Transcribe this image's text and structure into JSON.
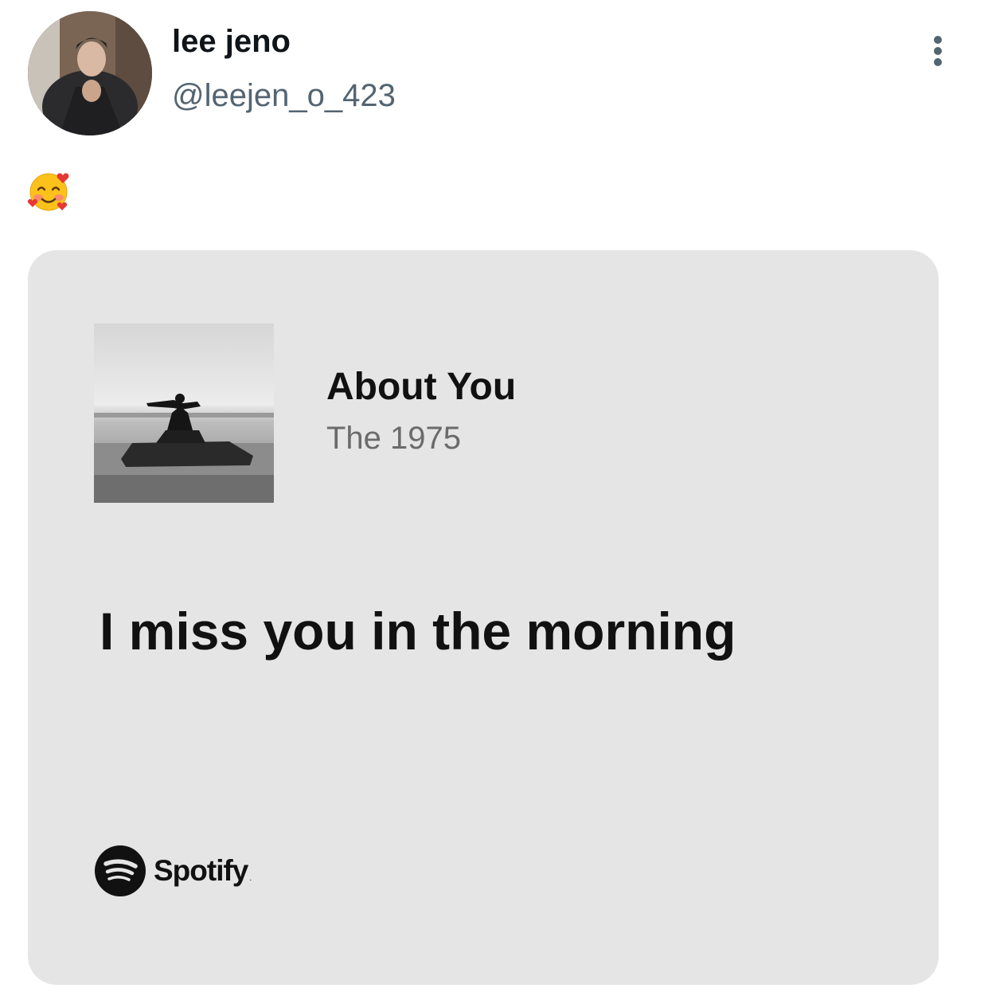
{
  "post": {
    "author": {
      "display_name": "lee jeno",
      "handle": "@leejen_o_423",
      "avatar": "profile-photo"
    },
    "menu_icon": "more-vertical-icon",
    "body_emoji": "🥰"
  },
  "card": {
    "song_title": "About You",
    "artist": "The 1975",
    "lyric": "I miss you in the morning",
    "album_art": "album-cover-photo",
    "brand": {
      "name": "Spotify",
      "logo_icon": "spotify-logo-icon"
    },
    "background_color": "#e5e5e5"
  },
  "colors": {
    "name_text": "#0f1419",
    "handle_text": "#536471",
    "artist_text": "#6b6b6b",
    "lyric_text": "#111111"
  }
}
